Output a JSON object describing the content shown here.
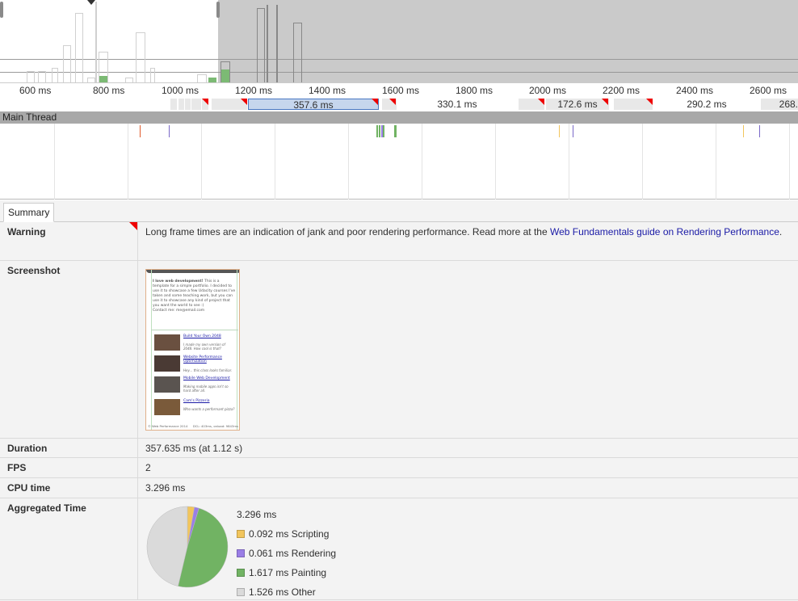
{
  "ruler": {
    "ticks": [
      "600 ms",
      "800 ms",
      "1000 ms",
      "1200 ms",
      "1400 ms",
      "1600 ms",
      "1800 ms",
      "2000 ms",
      "2200 ms",
      "2400 ms",
      "2600 ms"
    ]
  },
  "frames": {
    "labels": [
      "357.6 ms",
      "330.1 ms",
      "172.6 ms",
      "290.2 ms",
      "268."
    ]
  },
  "main_thread": {
    "title": "Main Thread"
  },
  "tabs": {
    "summary": "Summary"
  },
  "details": {
    "warning": {
      "key": "Warning",
      "text": "Long frame times are an indication of jank and poor rendering performance. Read more at the ",
      "link": "Web Fundamentals guide on Rendering Performance",
      "suffix": "."
    },
    "screenshot": {
      "key": "Screenshot",
      "intro_bold": "I love web development!",
      "intro": " This is a template for a simple portfolio. I decided to use it to showcase a few Udacity courses I've taken and some teaching work, but you can use it to showcase any kind of project that you want the world to see :)",
      "contact": "Contact me: me@email.com",
      "items": [
        {
          "title": "Build Your Own 2048",
          "sub": "I made my own version of 2048. How cool is that?"
        },
        {
          "title": "Website Performance Optimization",
          "sub": "Hey... this class looks familiar."
        },
        {
          "title": "Mobile Web Development",
          "sub": "Making mobile apps isn't so hard after all."
        },
        {
          "title": "Cam's Pizzeria",
          "sub": "Who wants a performant pizza?"
        }
      ],
      "footer_left": "© Web Performance 2014",
      "footer_right": "DCL: 403ms, onload: 9843ms"
    },
    "duration": {
      "key": "Duration",
      "value": "357.635 ms (at 1.12 s)"
    },
    "fps": {
      "key": "FPS",
      "value": "2"
    },
    "cpu": {
      "key": "CPU time",
      "value": "3.296 ms"
    },
    "aggregated": {
      "key": "Aggregated Time",
      "total": "3.296 ms",
      "slices": [
        {
          "label": "0.092 ms Scripting",
          "value": 0.092,
          "color": "#f2c55c"
        },
        {
          "label": "0.061 ms Rendering",
          "value": 0.061,
          "color": "#9a7ee6"
        },
        {
          "label": "1.617 ms Painting",
          "value": 1.617,
          "color": "#71b363"
        },
        {
          "label": "1.526 ms Other",
          "value": 1.526,
          "color": "#dadada"
        }
      ]
    }
  }
}
